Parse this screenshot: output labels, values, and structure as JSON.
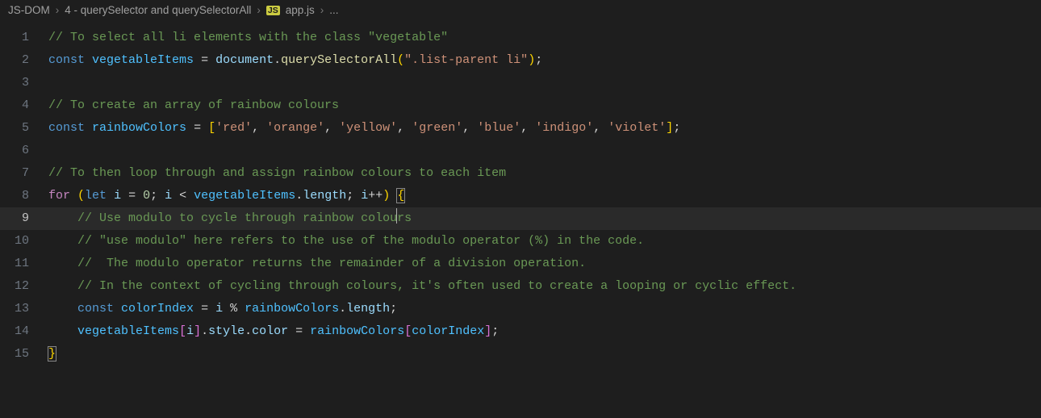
{
  "breadcrumb": {
    "root": "JS-DOM",
    "folder": "4 - querySelector and querySelectorAll",
    "badge": "JS",
    "file": "app.js",
    "tail": "..."
  },
  "code": {
    "l1_comment": "// To select all li elements with the class \"vegetable\"",
    "l2_const": "const",
    "l2_var": "vegetableItems",
    "l2_eq": " = ",
    "l2_doc": "document",
    "l2_dot1": ".",
    "l2_fn": "querySelectorAll",
    "l2_lp": "(",
    "l2_str": "\".list-parent li\"",
    "l2_rp": ")",
    "l2_semi": ";",
    "l4_comment": "// To create an array of rainbow colours",
    "l5_const": "const",
    "l5_var": "rainbowColors",
    "l5_eq": " = ",
    "l5_lb": "[",
    "l5_s1": "'red'",
    "l5_c1": ", ",
    "l5_s2": "'orange'",
    "l5_c2": ", ",
    "l5_s3": "'yellow'",
    "l5_c3": ", ",
    "l5_s4": "'green'",
    "l5_c4": ", ",
    "l5_s5": "'blue'",
    "l5_c5": ", ",
    "l5_s6": "'indigo'",
    "l5_c6": ", ",
    "l5_s7": "'violet'",
    "l5_rb": "]",
    "l5_semi": ";",
    "l7_comment": "// To then loop through and assign rainbow colours to each item",
    "l8_for": "for",
    "l8_sp1": " ",
    "l8_lp": "(",
    "l8_let": "let",
    "l8_sp2": " ",
    "l8_i1": "i",
    "l8_eq": " = ",
    "l8_zero": "0",
    "l8_semi1": "; ",
    "l8_i2": "i",
    "l8_lt": " < ",
    "l8_veg": "vegetableItems",
    "l8_dot": ".",
    "l8_len": "length",
    "l8_semi2": "; ",
    "l8_i3": "i",
    "l8_pp": "++",
    "l8_rp": ")",
    "l8_sp3": " ",
    "l8_lcb": "{",
    "l9_pre": "    // Use modulo to cycle through rainbow colou",
    "l9_post": "rs",
    "l10_comment": "    // \"use modulo\" here refers to the use of the modulo operator (%) in the code.",
    "l11_comment": "    //  The modulo operator returns the remainder of a division operation.",
    "l12_comment": "    // In the context of cycling through colours, it's often used to create a looping or cyclic effect.",
    "l13_indent": "    ",
    "l13_const": "const",
    "l13_sp": " ",
    "l13_var": "colorIndex",
    "l13_eq": " = ",
    "l13_i": "i",
    "l13_mod": " % ",
    "l13_rc": "rainbowColors",
    "l13_dot": ".",
    "l13_len": "length",
    "l13_semi": ";",
    "l14_indent": "    ",
    "l14_veg": "vegetableItems",
    "l14_lb": "[",
    "l14_i": "i",
    "l14_rb": "]",
    "l14_dot1": ".",
    "l14_style": "style",
    "l14_dot2": ".",
    "l14_color": "color",
    "l14_eq": " = ",
    "l14_rc": "rainbowColors",
    "l14_lb2": "[",
    "l14_ci": "colorIndex",
    "l14_rb2": "]",
    "l14_semi": ";",
    "l15_rcb": "}"
  },
  "gutter": {
    "g1": "1",
    "g2": "2",
    "g3": "3",
    "g4": "4",
    "g5": "5",
    "g6": "6",
    "g7": "7",
    "g8": "8",
    "g9": "9",
    "g10": "10",
    "g11": "11",
    "g12": "12",
    "g13": "13",
    "g14": "14",
    "g15": "15"
  }
}
